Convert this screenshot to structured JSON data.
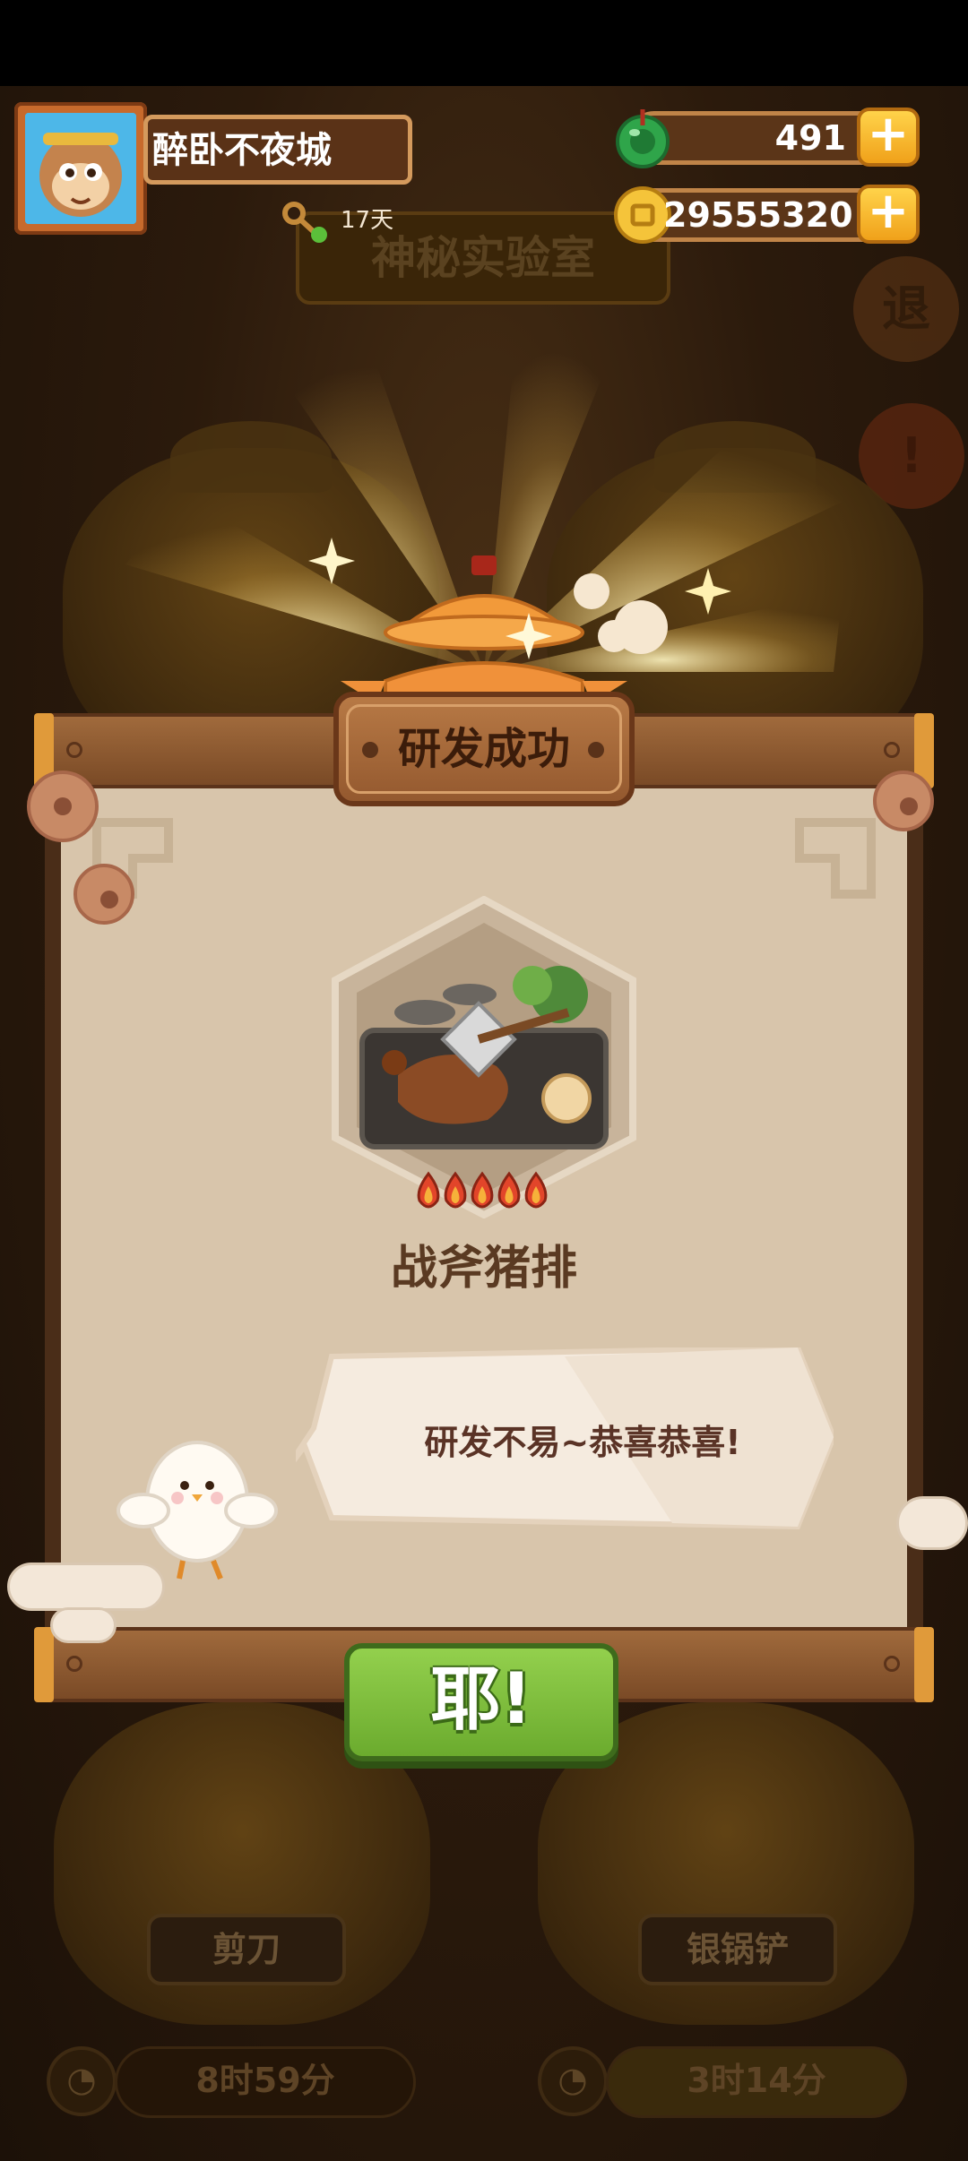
{
  "player": {
    "name": "醉卧不夜城",
    "days": "17天"
  },
  "resources": {
    "gems": "491",
    "coins": "29555320"
  },
  "background": {
    "lab_title": "神秘实验室",
    "side_exit": "退",
    "side_alert": "!",
    "bottom_left": {
      "name": "剪刀",
      "timer": "8时59分"
    },
    "bottom_right": {
      "name": "银锅铲",
      "timer": "3时14分"
    }
  },
  "modal": {
    "title": "研发成功",
    "dish_name": "战斧猪排",
    "spice_level": 5,
    "speech": "研发不易~恭喜恭喜!",
    "confirm_label": "耶!"
  },
  "colors": {
    "accent_gold": "#f0a11a",
    "button_green": "#7fbe3a",
    "wood": "#94592f"
  }
}
